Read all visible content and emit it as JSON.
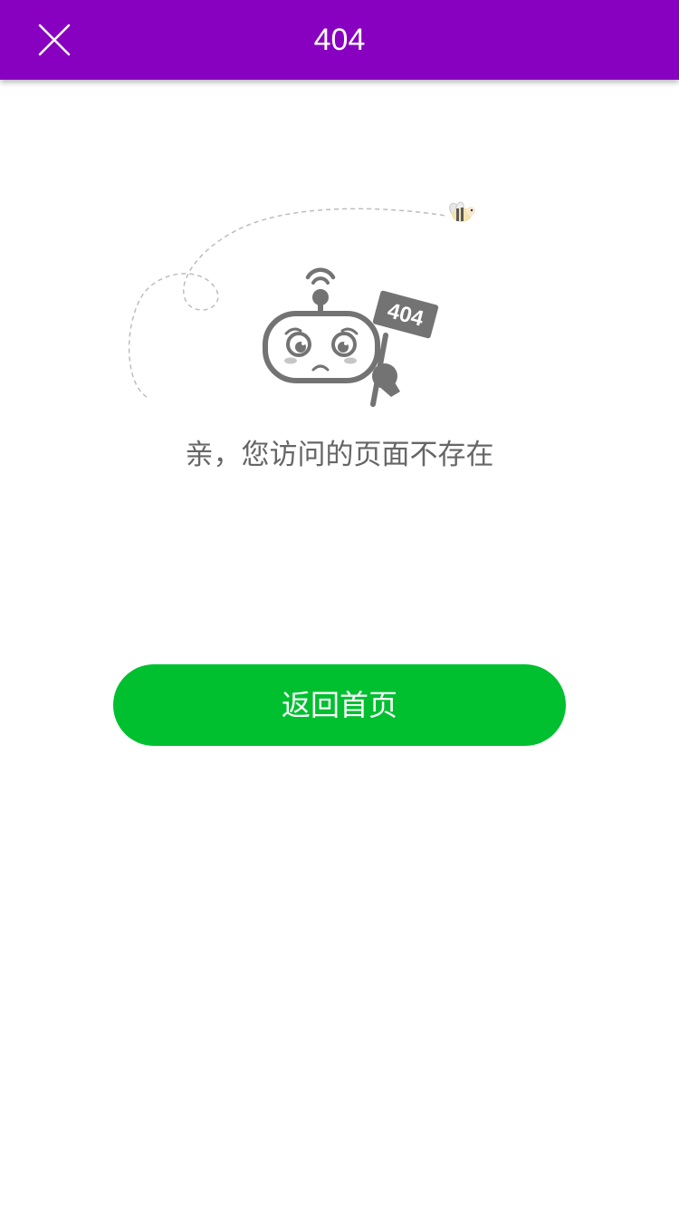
{
  "header": {
    "title": "404",
    "close_icon": "close-icon",
    "background_color": "#8800c0"
  },
  "illustration": {
    "icons": [
      "bee-icon",
      "sad-robot-icon",
      "flight-path-icon"
    ],
    "sign_text": "404"
  },
  "main": {
    "message": "亲，您访问的页面不存在",
    "home_button_label": "返回首页",
    "home_button_color": "#00c030"
  }
}
